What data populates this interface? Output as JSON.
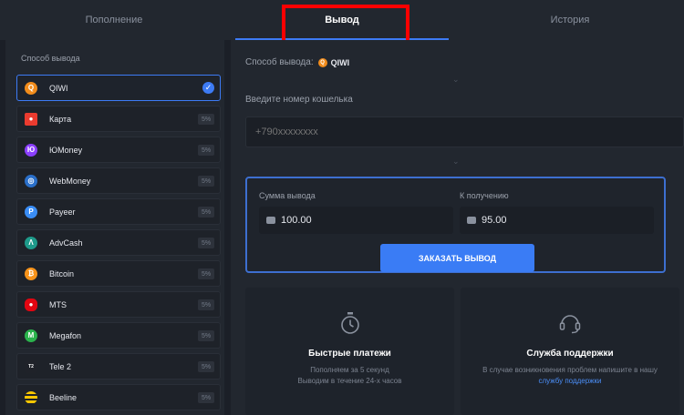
{
  "tabs": [
    {
      "label": "Пополнение"
    },
    {
      "label": "Вывод"
    },
    {
      "label": "История"
    }
  ],
  "sidebar": {
    "title": "Способ вывода",
    "methods": [
      {
        "label": "QIWI",
        "icon": "qiwi-icon",
        "color": "#f28c1b",
        "fee": ""
      },
      {
        "label": "Карта",
        "icon": "card-icon",
        "color": "#eb3b2f",
        "fee": "5%"
      },
      {
        "label": "ЮMoney",
        "icon": "yoomoney-icon",
        "color": "#8b3ffd",
        "fee": "5%"
      },
      {
        "label": "WebMoney",
        "icon": "webmoney-icon",
        "color": "#2a6fc9",
        "fee": "5%"
      },
      {
        "label": "Payeer",
        "icon": "payeer-icon",
        "color": "#3a8df5",
        "fee": "5%"
      },
      {
        "label": "AdvCash",
        "icon": "advcash-icon",
        "color": "#1e9a8a",
        "fee": "5%"
      },
      {
        "label": "Bitcoin",
        "icon": "bitcoin-icon",
        "color": "#f7931a",
        "fee": "5%"
      },
      {
        "label": "MTS",
        "icon": "mts-icon",
        "color": "#e30611",
        "fee": "5%"
      },
      {
        "label": "Megafon",
        "icon": "megafon-icon",
        "color": "#2bb24c",
        "fee": "5%"
      },
      {
        "label": "Tele 2",
        "icon": "tele2-icon",
        "color": "#1f2229",
        "fee": "5%"
      },
      {
        "label": "Beeline",
        "icon": "beeline-icon",
        "color": "#f7c600",
        "fee": "5%"
      }
    ]
  },
  "main": {
    "method_label": "Способ вывода:",
    "method_value": "QIWI",
    "wallet_label": "Введите номер кошелька",
    "wallet_placeholder": "+790xxxxxxxx",
    "amount_label": "Сумма вывода",
    "amount_value": "100.00",
    "receive_label": "К получению",
    "receive_value": "95.00",
    "order_button": "ЗАКАЗАТЬ ВЫВОД"
  },
  "info": {
    "fast": {
      "title": "Быстрые платежи",
      "line1": "Пополняем за 5 секунд",
      "line2": "Выводим в течение 24-х часов"
    },
    "support": {
      "title": "Служба поддержки",
      "line1": "В случае возникновения проблем напишите в нашу",
      "link": "службу поддержки"
    }
  },
  "colors": {
    "accent": "#3a7cf5",
    "highlight": "#ff0000"
  }
}
